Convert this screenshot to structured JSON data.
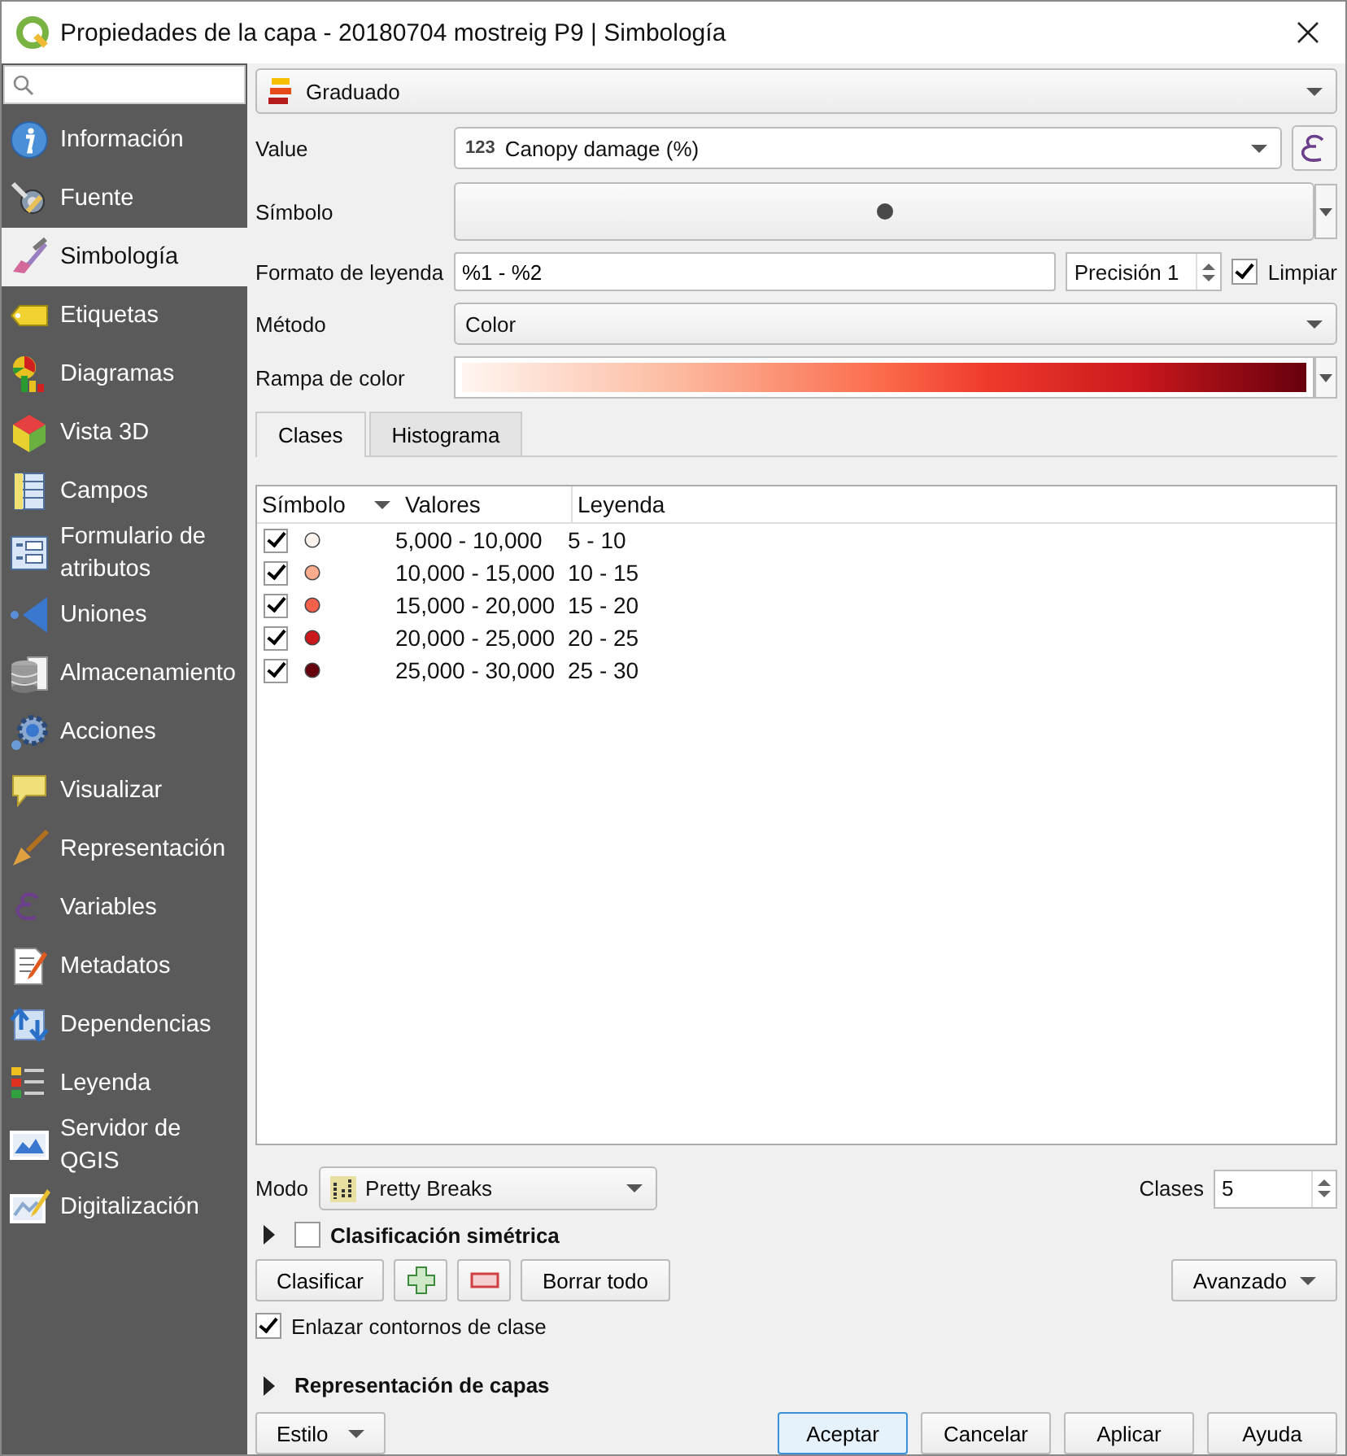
{
  "window": {
    "title": "Propiedades de la capa - 20180704 mostreig P9 | Simbología"
  },
  "sidebar": {
    "items": [
      {
        "label": "Información",
        "selected": false
      },
      {
        "label": "Fuente",
        "selected": false
      },
      {
        "label": "Simbología",
        "selected": true
      },
      {
        "label": "Etiquetas",
        "selected": false
      },
      {
        "label": "Diagramas",
        "selected": false
      },
      {
        "label": "Vista 3D",
        "selected": false
      },
      {
        "label": "Campos",
        "selected": false
      },
      {
        "label": "Formulario de atributos",
        "selected": false
      },
      {
        "label": "Uniones",
        "selected": false
      },
      {
        "label": "Almacenamiento",
        "selected": false
      },
      {
        "label": "Acciones",
        "selected": false
      },
      {
        "label": "Visualizar",
        "selected": false
      },
      {
        "label": "Representación",
        "selected": false
      },
      {
        "label": "Variables",
        "selected": false
      },
      {
        "label": "Metadatos",
        "selected": false
      },
      {
        "label": "Dependencias",
        "selected": false
      },
      {
        "label": "Leyenda",
        "selected": false
      },
      {
        "label": "Servidor de QGIS",
        "selected": false
      },
      {
        "label": "Digitalización",
        "selected": false
      }
    ]
  },
  "renderer": {
    "value": "Graduado"
  },
  "value_field": {
    "label": "Value",
    "type_badge": "123",
    "value": "Canopy damage (%)"
  },
  "symbol": {
    "label": "Símbolo"
  },
  "legend_format": {
    "label": "Formato de leyenda",
    "value": "%1 - %2",
    "precision": "Precisión 1",
    "trim": {
      "label": "Limpiar",
      "checked": true
    }
  },
  "method": {
    "label": "Método",
    "value": "Color"
  },
  "color_ramp": {
    "label": "Rampa de color"
  },
  "tabs": [
    {
      "label": "Clases",
      "selected": true
    },
    {
      "label": "Histograma",
      "selected": false
    }
  ],
  "table": {
    "columns": [
      "Símbolo",
      "Valores",
      "Leyenda"
    ],
    "rows": [
      {
        "checked": true,
        "color": "#fff5f0",
        "values": "5,000 - 10,000",
        "legend": "5 - 10"
      },
      {
        "checked": true,
        "color": "#fcab8f",
        "values": "10,000 - 15,000",
        "legend": "10 - 15"
      },
      {
        "checked": true,
        "color": "#f4604a",
        "values": "15,000 - 20,000",
        "legend": "15 - 20"
      },
      {
        "checked": true,
        "color": "#cb181d",
        "values": "20,000 - 25,000",
        "legend": "20 - 25"
      },
      {
        "checked": true,
        "color": "#67000d",
        "values": "25,000 - 30,000",
        "legend": "25 - 30"
      }
    ]
  },
  "mode": {
    "label": "Modo",
    "value": "Pretty Breaks"
  },
  "classes": {
    "label": "Clases",
    "value": "5"
  },
  "symmetric": {
    "label": "Clasificación simétrica",
    "checked": false,
    "expanded": false
  },
  "classify_button": "Clasificar",
  "clear_button": "Borrar todo",
  "advanced_button": "Avanzado",
  "link_bounds": {
    "label": "Enlazar contornos de clase",
    "checked": true
  },
  "layer_rendering": {
    "label": "Representación de capas",
    "expanded": false
  },
  "style_button": "Estilo",
  "dialog_buttons": [
    {
      "label": "Aceptar",
      "focused": true
    },
    {
      "label": "Cancelar",
      "focused": false
    },
    {
      "label": "Aplicar",
      "focused": false
    },
    {
      "label": "Ayuda",
      "focused": false
    }
  ]
}
